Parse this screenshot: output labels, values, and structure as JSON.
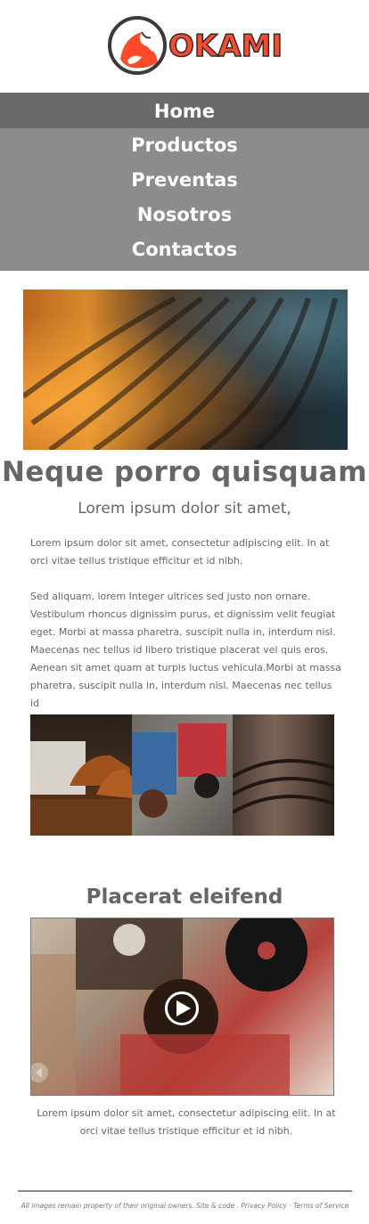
{
  "brand": {
    "name": "OKAMI",
    "accent": "#ff4a2a"
  },
  "nav": {
    "items": [
      {
        "label": "Home",
        "active": true
      },
      {
        "label": "Productos",
        "active": false
      },
      {
        "label": "Preventas",
        "active": false
      },
      {
        "label": "Nosotros",
        "active": false
      },
      {
        "label": "Contactos",
        "active": false
      }
    ]
  },
  "main": {
    "title": "Neque porro quisquam",
    "subtitle": "Lorem ipsum dolor sit amet,",
    "paragraph1": "Lorem ipsum dolor sit amet, consectetur adipiscing elit. In at orci vitae tellus tristique efficitur et id nibh.",
    "paragraph2": "Sed aliquam, lorem Integer ultrices sed justo non ornare. Vestibulum rhoncus dignissim purus, et dignissim velit feugiat eget. Morbi at massa pharetra, suscipit nulla in, interdum nisl. Maecenas nec tellus id libero tristique placerat vel quis eros. Aenean sit amet quam at turpis luctus vehicula.Morbi at massa pharetra, suscipit nulla in, interdum nisl. Maecenas nec tellus id"
  },
  "video_section": {
    "title": "Placerat eleifend",
    "caption": "Lorem ipsum dolor sit amet, consectetur adipiscing elit. In at orci vitae tellus tristique efficitur et id nibh."
  },
  "footer": {
    "text": "All images remain property of their original owners. Site & code .",
    "privacy": "Privacy Policy",
    "separator": "·",
    "terms": "Terms of Service"
  },
  "icons": {
    "play": "play-icon",
    "logo": "fox-logo-icon"
  }
}
